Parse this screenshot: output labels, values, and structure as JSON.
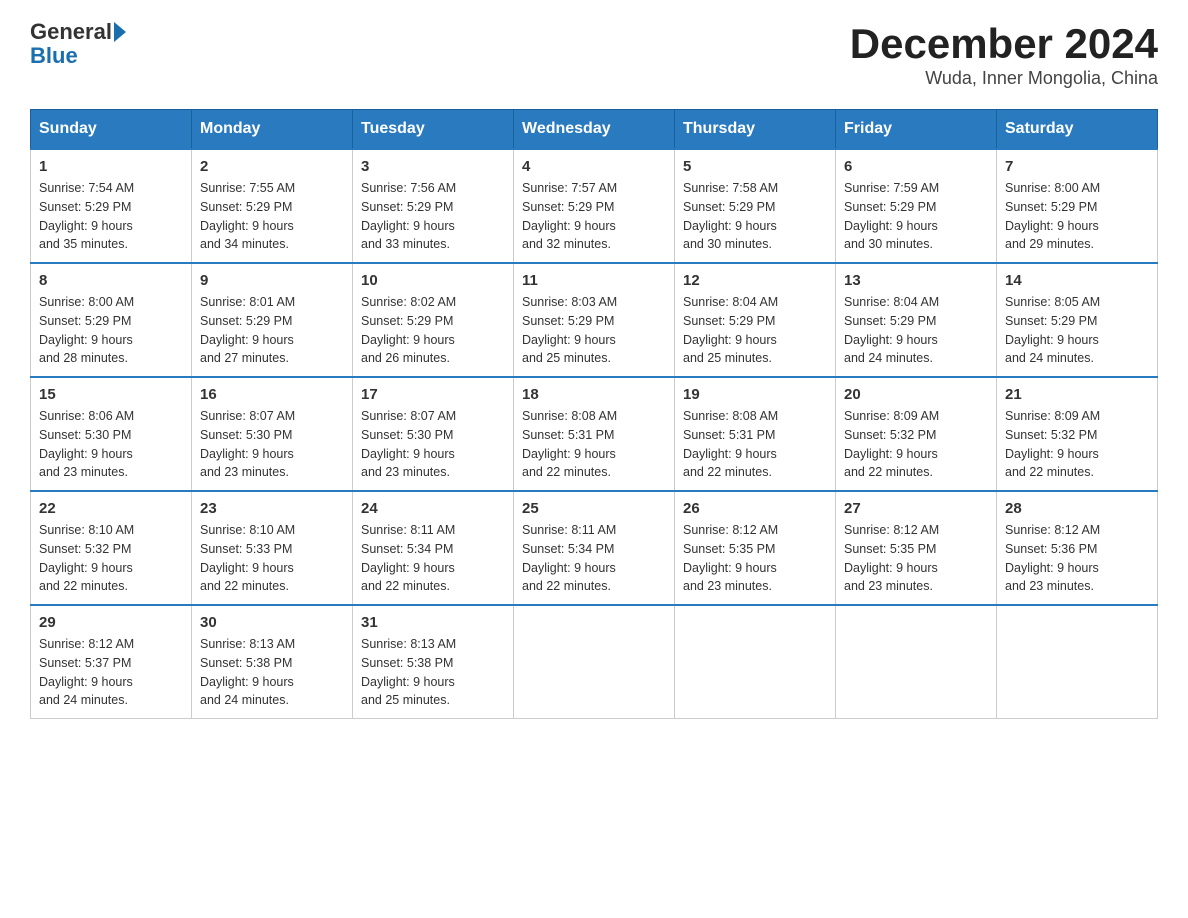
{
  "header": {
    "logo": {
      "general": "General",
      "blue": "Blue"
    },
    "title": "December 2024",
    "location": "Wuda, Inner Mongolia, China"
  },
  "weekdays": [
    "Sunday",
    "Monday",
    "Tuesday",
    "Wednesday",
    "Thursday",
    "Friday",
    "Saturday"
  ],
  "weeks": [
    [
      {
        "day": "1",
        "sunrise": "7:54 AM",
        "sunset": "5:29 PM",
        "daylight": "9 hours and 35 minutes."
      },
      {
        "day": "2",
        "sunrise": "7:55 AM",
        "sunset": "5:29 PM",
        "daylight": "9 hours and 34 minutes."
      },
      {
        "day": "3",
        "sunrise": "7:56 AM",
        "sunset": "5:29 PM",
        "daylight": "9 hours and 33 minutes."
      },
      {
        "day": "4",
        "sunrise": "7:57 AM",
        "sunset": "5:29 PM",
        "daylight": "9 hours and 32 minutes."
      },
      {
        "day": "5",
        "sunrise": "7:58 AM",
        "sunset": "5:29 PM",
        "daylight": "9 hours and 30 minutes."
      },
      {
        "day": "6",
        "sunrise": "7:59 AM",
        "sunset": "5:29 PM",
        "daylight": "9 hours and 30 minutes."
      },
      {
        "day": "7",
        "sunrise": "8:00 AM",
        "sunset": "5:29 PM",
        "daylight": "9 hours and 29 minutes."
      }
    ],
    [
      {
        "day": "8",
        "sunrise": "8:00 AM",
        "sunset": "5:29 PM",
        "daylight": "9 hours and 28 minutes."
      },
      {
        "day": "9",
        "sunrise": "8:01 AM",
        "sunset": "5:29 PM",
        "daylight": "9 hours and 27 minutes."
      },
      {
        "day": "10",
        "sunrise": "8:02 AM",
        "sunset": "5:29 PM",
        "daylight": "9 hours and 26 minutes."
      },
      {
        "day": "11",
        "sunrise": "8:03 AM",
        "sunset": "5:29 PM",
        "daylight": "9 hours and 25 minutes."
      },
      {
        "day": "12",
        "sunrise": "8:04 AM",
        "sunset": "5:29 PM",
        "daylight": "9 hours and 25 minutes."
      },
      {
        "day": "13",
        "sunrise": "8:04 AM",
        "sunset": "5:29 PM",
        "daylight": "9 hours and 24 minutes."
      },
      {
        "day": "14",
        "sunrise": "8:05 AM",
        "sunset": "5:29 PM",
        "daylight": "9 hours and 24 minutes."
      }
    ],
    [
      {
        "day": "15",
        "sunrise": "8:06 AM",
        "sunset": "5:30 PM",
        "daylight": "9 hours and 23 minutes."
      },
      {
        "day": "16",
        "sunrise": "8:07 AM",
        "sunset": "5:30 PM",
        "daylight": "9 hours and 23 minutes."
      },
      {
        "day": "17",
        "sunrise": "8:07 AM",
        "sunset": "5:30 PM",
        "daylight": "9 hours and 23 minutes."
      },
      {
        "day": "18",
        "sunrise": "8:08 AM",
        "sunset": "5:31 PM",
        "daylight": "9 hours and 22 minutes."
      },
      {
        "day": "19",
        "sunrise": "8:08 AM",
        "sunset": "5:31 PM",
        "daylight": "9 hours and 22 minutes."
      },
      {
        "day": "20",
        "sunrise": "8:09 AM",
        "sunset": "5:32 PM",
        "daylight": "9 hours and 22 minutes."
      },
      {
        "day": "21",
        "sunrise": "8:09 AM",
        "sunset": "5:32 PM",
        "daylight": "9 hours and 22 minutes."
      }
    ],
    [
      {
        "day": "22",
        "sunrise": "8:10 AM",
        "sunset": "5:32 PM",
        "daylight": "9 hours and 22 minutes."
      },
      {
        "day": "23",
        "sunrise": "8:10 AM",
        "sunset": "5:33 PM",
        "daylight": "9 hours and 22 minutes."
      },
      {
        "day": "24",
        "sunrise": "8:11 AM",
        "sunset": "5:34 PM",
        "daylight": "9 hours and 22 minutes."
      },
      {
        "day": "25",
        "sunrise": "8:11 AM",
        "sunset": "5:34 PM",
        "daylight": "9 hours and 22 minutes."
      },
      {
        "day": "26",
        "sunrise": "8:12 AM",
        "sunset": "5:35 PM",
        "daylight": "9 hours and 23 minutes."
      },
      {
        "day": "27",
        "sunrise": "8:12 AM",
        "sunset": "5:35 PM",
        "daylight": "9 hours and 23 minutes."
      },
      {
        "day": "28",
        "sunrise": "8:12 AM",
        "sunset": "5:36 PM",
        "daylight": "9 hours and 23 minutes."
      }
    ],
    [
      {
        "day": "29",
        "sunrise": "8:12 AM",
        "sunset": "5:37 PM",
        "daylight": "9 hours and 24 minutes."
      },
      {
        "day": "30",
        "sunrise": "8:13 AM",
        "sunset": "5:38 PM",
        "daylight": "9 hours and 24 minutes."
      },
      {
        "day": "31",
        "sunrise": "8:13 AM",
        "sunset": "5:38 PM",
        "daylight": "9 hours and 25 minutes."
      },
      null,
      null,
      null,
      null
    ]
  ],
  "labels": {
    "sunrise": "Sunrise:",
    "sunset": "Sunset:",
    "daylight": "Daylight:"
  }
}
